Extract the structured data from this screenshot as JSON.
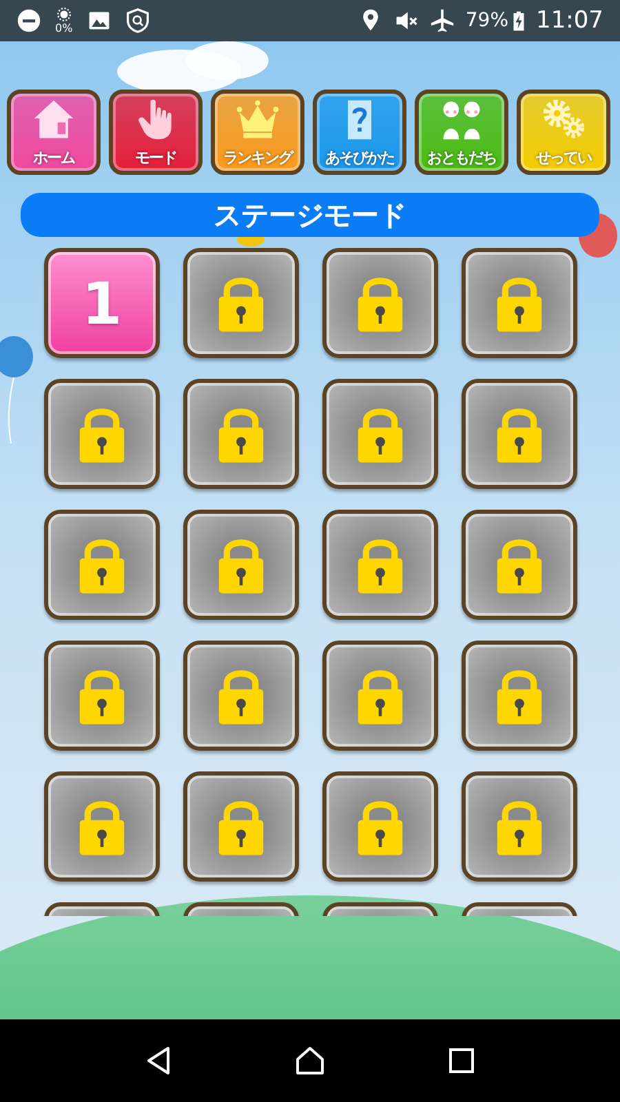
{
  "status_bar": {
    "brightness": "0%",
    "battery": "79%",
    "time": "11:07"
  },
  "menu": [
    {
      "label": "ホーム",
      "kind": "home",
      "color": "#f0489e"
    },
    {
      "label": "モード",
      "kind": "hand",
      "color": "#e41e3a"
    },
    {
      "label": "ランキング",
      "kind": "crown",
      "color": "#fb9a1a"
    },
    {
      "label": "あそびかた",
      "kind": "question",
      "color": "#1a98ec"
    },
    {
      "label": "おともだち",
      "kind": "friends",
      "color": "#4cbc12"
    },
    {
      "label": "せってい",
      "kind": "gears",
      "color": "#f6cc00"
    }
  ],
  "title": "ステージモード",
  "stages": [
    {
      "label": "1",
      "locked": false
    },
    {
      "locked": true
    },
    {
      "locked": true
    },
    {
      "locked": true
    },
    {
      "locked": true
    },
    {
      "locked": true
    },
    {
      "locked": true
    },
    {
      "locked": true
    },
    {
      "locked": true
    },
    {
      "locked": true
    },
    {
      "locked": true
    },
    {
      "locked": true
    },
    {
      "locked": true
    },
    {
      "locked": true
    },
    {
      "locked": true
    },
    {
      "locked": true
    },
    {
      "locked": true
    },
    {
      "locked": true
    },
    {
      "locked": true
    },
    {
      "locked": true
    },
    {
      "locked": true
    },
    {
      "locked": true
    },
    {
      "locked": true
    },
    {
      "locked": true
    }
  ]
}
